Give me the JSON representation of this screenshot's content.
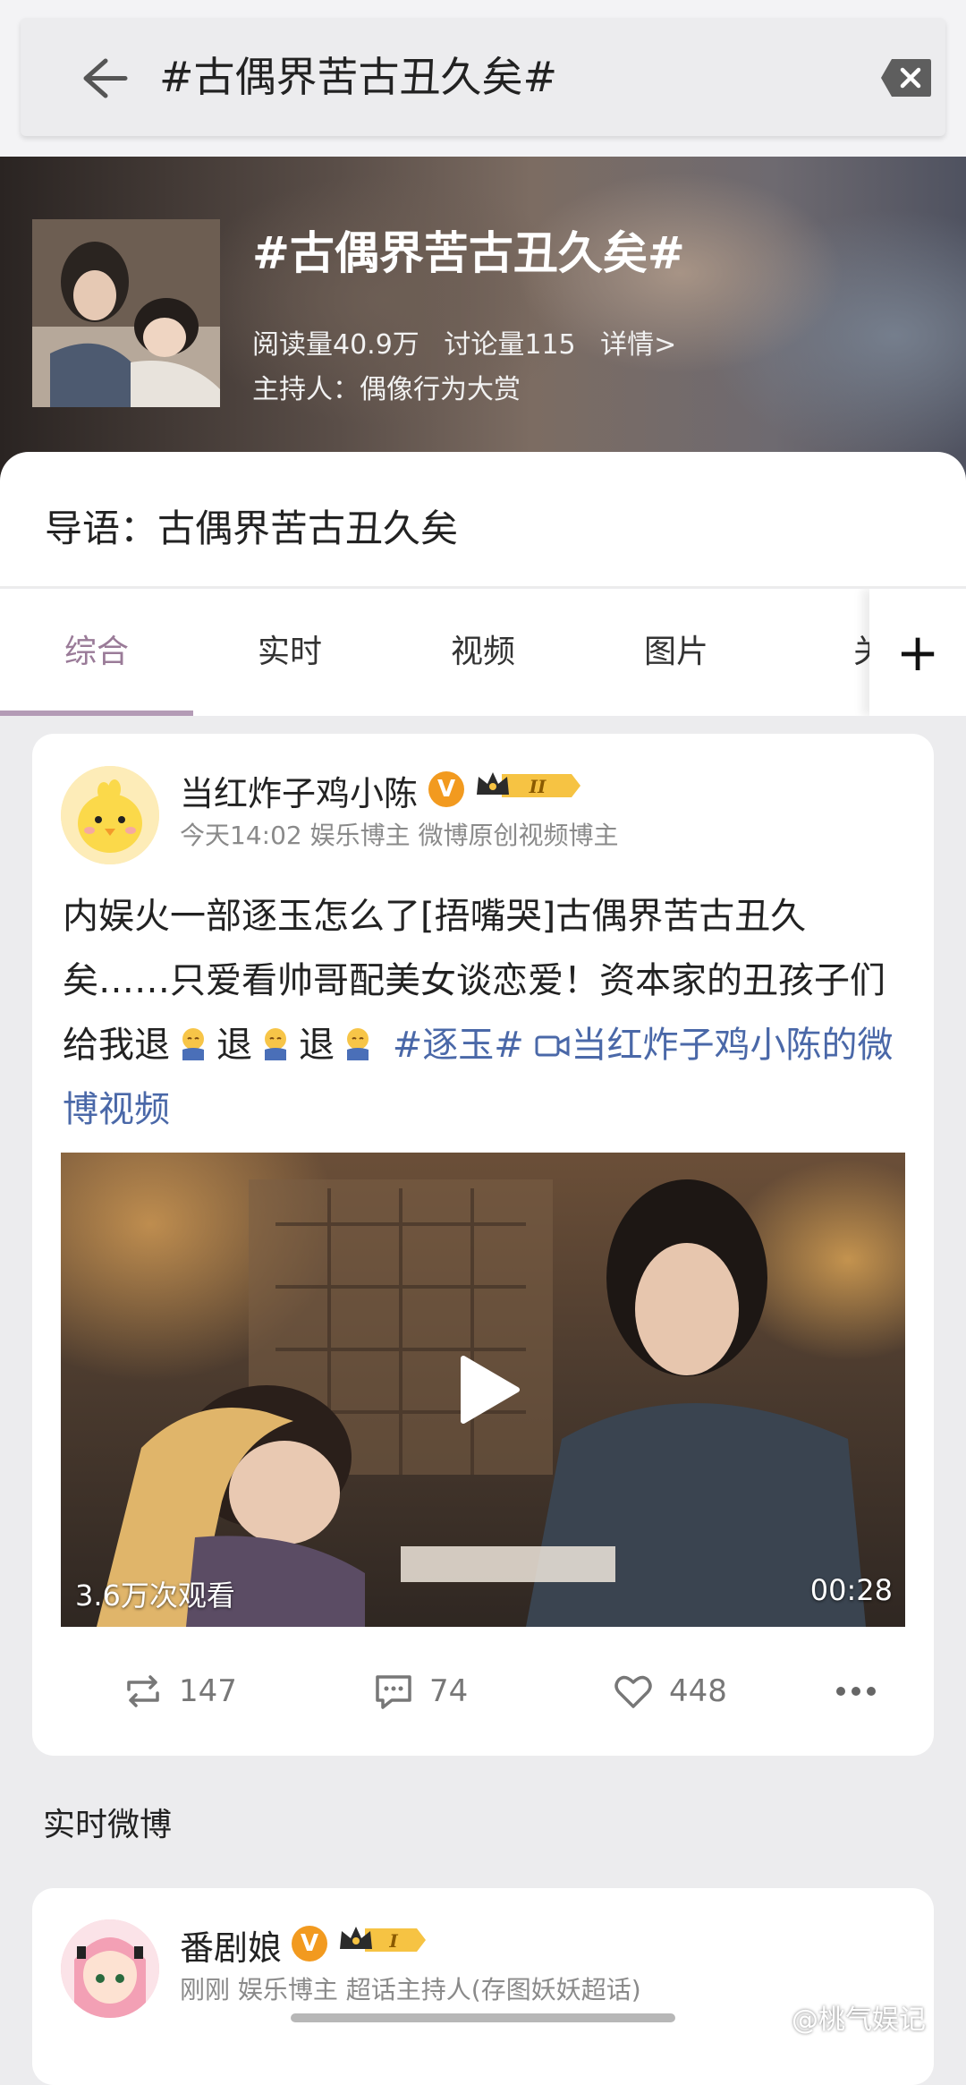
{
  "search": {
    "query": "#古偶界苦古丑久矣#"
  },
  "topic": {
    "title": "#古偶界苦古丑久矣#",
    "reads": "阅读量40.9万",
    "discussions": "讨论量115",
    "details_link": "详情>",
    "host": "主持人：偶像行为大赏"
  },
  "intro": {
    "text": "导语：古偶界苦古丑久矣"
  },
  "tabs": [
    "综合",
    "实时",
    "视频",
    "图片",
    "关"
  ],
  "post": {
    "author": "当红炸子鸡小陈",
    "verified_badge": "V",
    "crown_level": "II",
    "meta": "今天14:02   娱乐博主 微博原创视频博主",
    "text_main": "内娱火一部逐玉怎么了[捂嘴哭]古偶界苦古丑久矣……只爱看帅哥配美女谈恋爱！资本家的丑孩子们给我退",
    "text_tui": "退",
    "hashtag": "#逐玉#",
    "video_link": "当红炸子鸡小陈的微博视频",
    "video": {
      "views": "3.6万次观看",
      "duration": "00:28"
    },
    "reposts": "147",
    "comments": "74",
    "likes": "448"
  },
  "section": {
    "title": "实时微博"
  },
  "post2": {
    "author": "番剧娘",
    "verified_badge": "V",
    "crown_level": "I",
    "meta": "刚刚   娱乐博主 超话主持人(存图妖妖超话)"
  },
  "watermark": "@桃气娱记",
  "colors": {
    "tab_active": "#9a7b98",
    "link": "#4a68a8",
    "verified": "#f29a1f"
  }
}
